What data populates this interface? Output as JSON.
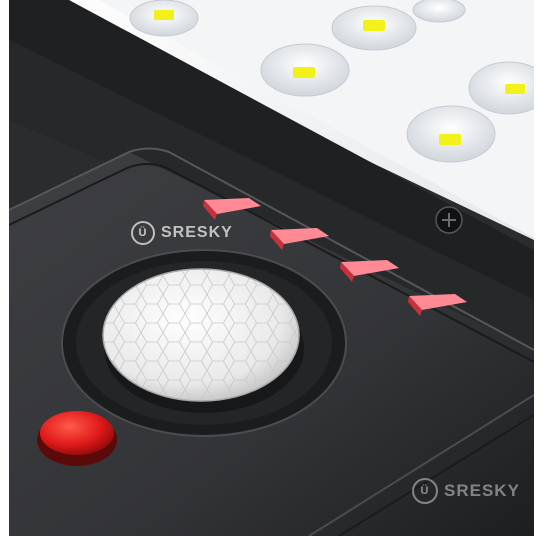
{
  "watermarks": {
    "top": {
      "badge": "Ü",
      "text": "SRESKY"
    },
    "bottom": {
      "badge": "Ü",
      "text": "SRESKY"
    }
  },
  "colors": {
    "housing": "#2b2c2e",
    "panel": "#3a3b3e",
    "led_panel": "#f2f3f5",
    "led_chip": "#f2f21a",
    "indicator": "#ff4a5a",
    "button": "#e11d1d",
    "pir_sensor": "#eeeeee"
  },
  "icons": [
    "pir-sensor-dome",
    "red-power-button",
    "screw-icon",
    "led-lens",
    "indicator-light"
  ]
}
